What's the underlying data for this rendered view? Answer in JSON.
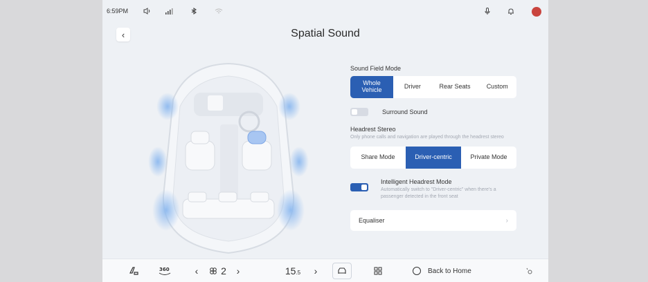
{
  "status_bar": {
    "time": "6:59PM",
    "icons": [
      "volume-icon",
      "signal-icon",
      "bluetooth-icon",
      "wifi-icon",
      "microphone-icon",
      "notification-bell-icon",
      "user-avatar"
    ]
  },
  "header": {
    "title": "Spatial Sound",
    "back_icon": "chevron-left-icon"
  },
  "sound_field": {
    "label": "Sound Field Mode",
    "options": [
      "Whole Vehicle",
      "Driver",
      "Rear Seats",
      "Custom"
    ],
    "selected": "Whole Vehicle"
  },
  "surround": {
    "label": "Surround Sound",
    "enabled": false
  },
  "headrest": {
    "title": "Headrest Stereo",
    "description": "Only phone calls and navigation are played through the headrest stereo",
    "options": [
      "Share Mode",
      "Driver-centric",
      "Private Mode"
    ],
    "selected": "Driver-centric"
  },
  "intelligent": {
    "label": "Intelligent Headrest Mode",
    "description": "Automatically switch to \"Driver-centric\" when there's a passenger detected in the front seat",
    "enabled": true
  },
  "equaliser": {
    "label": "Equaliser"
  },
  "dock": {
    "seat_value": "2",
    "temperature": "15",
    "temperature_decimal": ".5",
    "back_home_label": "Back to Home",
    "icons": [
      "car-settings-icon",
      "camera-360-icon",
      "fan-icon",
      "car-view-icon",
      "apps-grid-icon",
      "home-circle-icon",
      "settings-icon"
    ]
  },
  "colors": {
    "accent": "#2b5fb3",
    "speaker_glow": "#7aaee8"
  }
}
